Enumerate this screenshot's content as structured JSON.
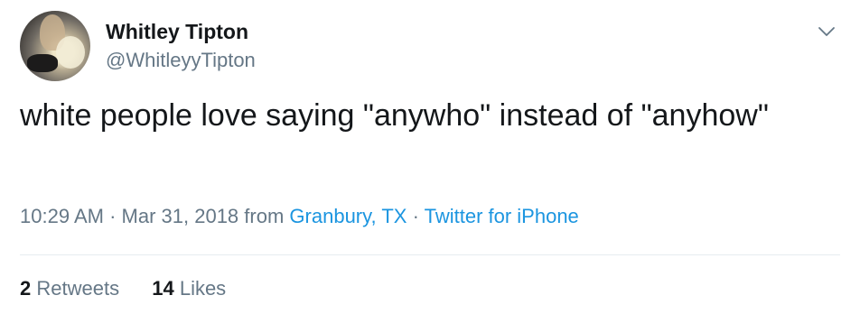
{
  "author": {
    "name": "Whitley Tipton",
    "handle": "@WhitleyyTipton"
  },
  "tweet": {
    "text": "white people love saying \"anywho\" instead of \"anyhow\""
  },
  "meta": {
    "time": "10:29 AM",
    "date": "Mar 31, 2018",
    "from_label": "from",
    "location": "Granbury, TX",
    "separator": "·",
    "source": "Twitter for iPhone"
  },
  "stats": {
    "retweets_count": "2",
    "retweets_label": "Retweets",
    "likes_count": "14",
    "likes_label": "Likes"
  },
  "icons": {
    "menu": "chevron-down-icon"
  },
  "colors": {
    "text": "#14171a",
    "secondary": "#657786",
    "link": "#1b95e0",
    "divider": "#e6ecf0"
  }
}
